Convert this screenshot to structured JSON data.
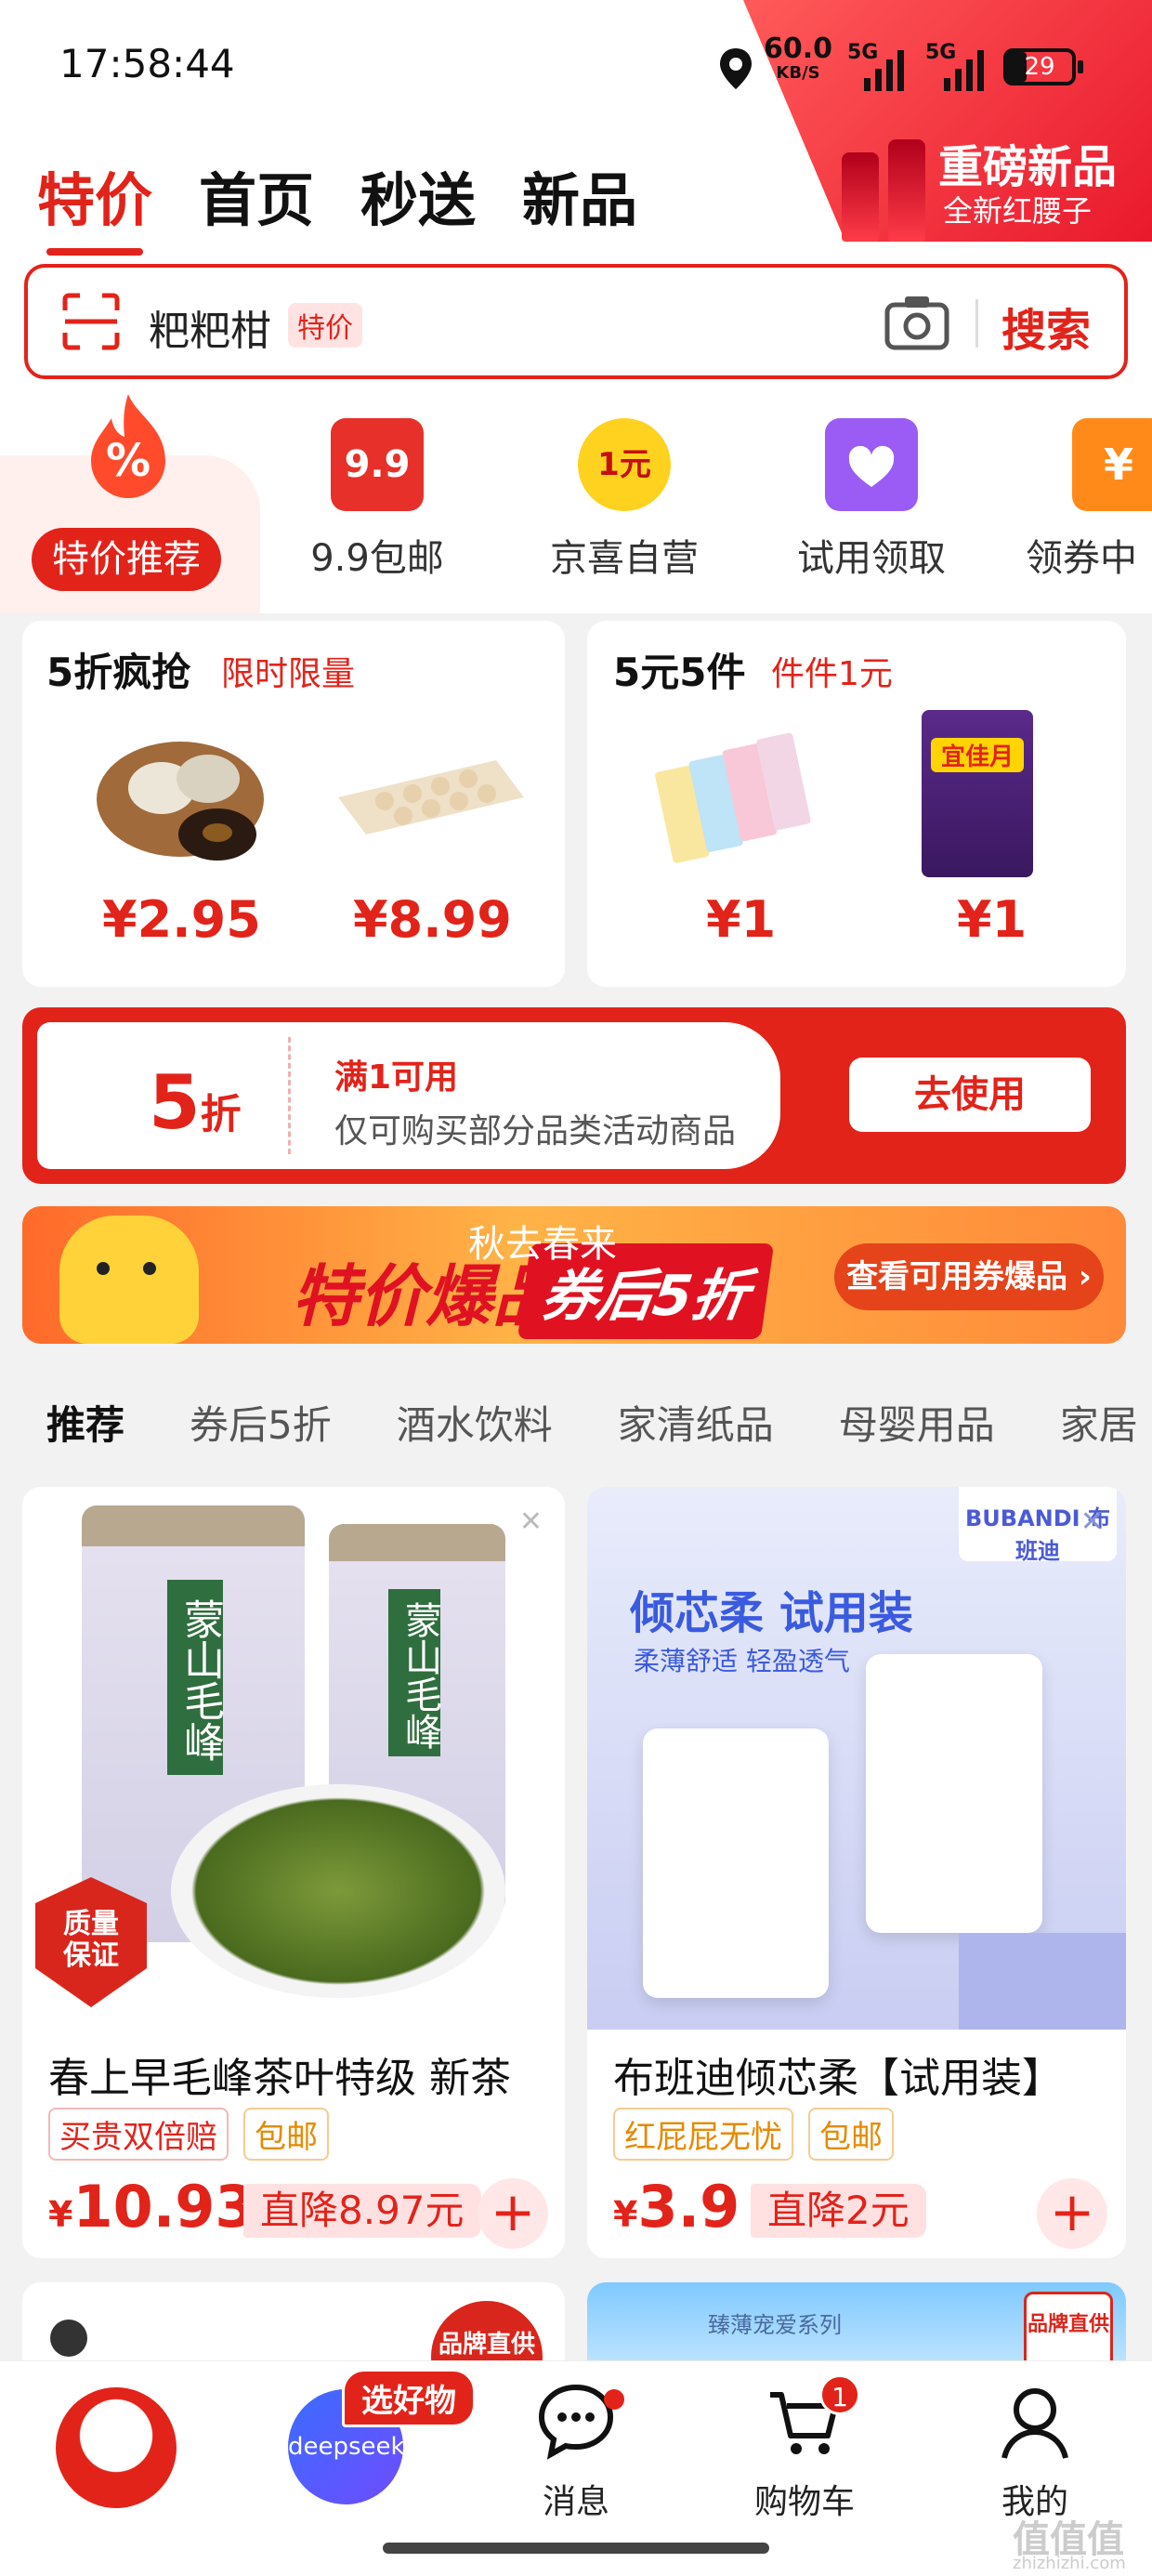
{
  "status": {
    "time": "17:58:44",
    "net_speed": "60.0",
    "net_unit": "KB/S",
    "sig1": "5G",
    "sig2": "5G",
    "battery": "29"
  },
  "promo": {
    "title": "重磅新品",
    "subtitle": "全新红腰子"
  },
  "top_tabs": [
    "特价",
    "首页",
    "秒送",
    "新品"
  ],
  "search": {
    "text": "粑粑柑",
    "badge": "特价",
    "button": "搜索"
  },
  "quick": {
    "first": "特价推荐",
    "items": [
      {
        "label": "9.9包邮",
        "icon": "9.9"
      },
      {
        "label": "京喜自营",
        "icon": "1元"
      },
      {
        "label": "试用领取",
        "icon": "heart-bag-icon"
      },
      {
        "label": "领券中",
        "icon": "¥"
      }
    ]
  },
  "deals": [
    {
      "title": "5折疯抢",
      "sub": "限时限量",
      "prices": [
        "¥2.95",
        "¥8.99"
      ]
    },
    {
      "title": "5元5件",
      "sub": "件件1元",
      "prices": [
        "¥1",
        "¥1"
      ],
      "product_text": "宜佳月"
    }
  ],
  "coupon": {
    "discount": "5",
    "unit": "折",
    "condition": "满1可用",
    "desc": "仅可购买部分品类活动商品",
    "button": "去使用"
  },
  "banner": {
    "main": "特价爆品",
    "tag": "券后5折",
    "overlay": "秋去春来",
    "button": "查看可用券爆品 ›"
  },
  "categories": [
    "推荐",
    "券后5折",
    "酒水饮料",
    "家清纸品",
    "母婴用品",
    "家居"
  ],
  "products": [
    {
      "title": "春上早毛峰茶叶特级 新茶",
      "tags": [
        "买贵双倍赔",
        "包邮"
      ],
      "price": "10.93",
      "drop": "直降8.97元",
      "img_text": "蒙山毛峰",
      "badge": "质量保证"
    },
    {
      "title": "布班迪倾芯柔【试用装】",
      "tags": [
        "红屁屁无忧",
        "包邮"
      ],
      "price": "3.9",
      "drop": "直降2元",
      "img_title": "倾芯柔 试用装",
      "img_sub": "柔薄舒适 轻盈透气",
      "brand": "BUBANDI 布班迪"
    }
  ],
  "peek": {
    "left_badge": "品牌直供",
    "right_text": "臻薄宠爱系列",
    "right_badge": "品牌直供"
  },
  "nav": {
    "ds_label": "deepseek",
    "ds_tag": "选好物",
    "msg": "消息",
    "cart": "购物车",
    "cart_count": "1",
    "me": "我的"
  },
  "watermark": {
    "text": "值值值",
    "url": "zhizhizhi.com"
  },
  "colors": {
    "accent": "#e2231a",
    "orange": "#ff8a3a"
  }
}
